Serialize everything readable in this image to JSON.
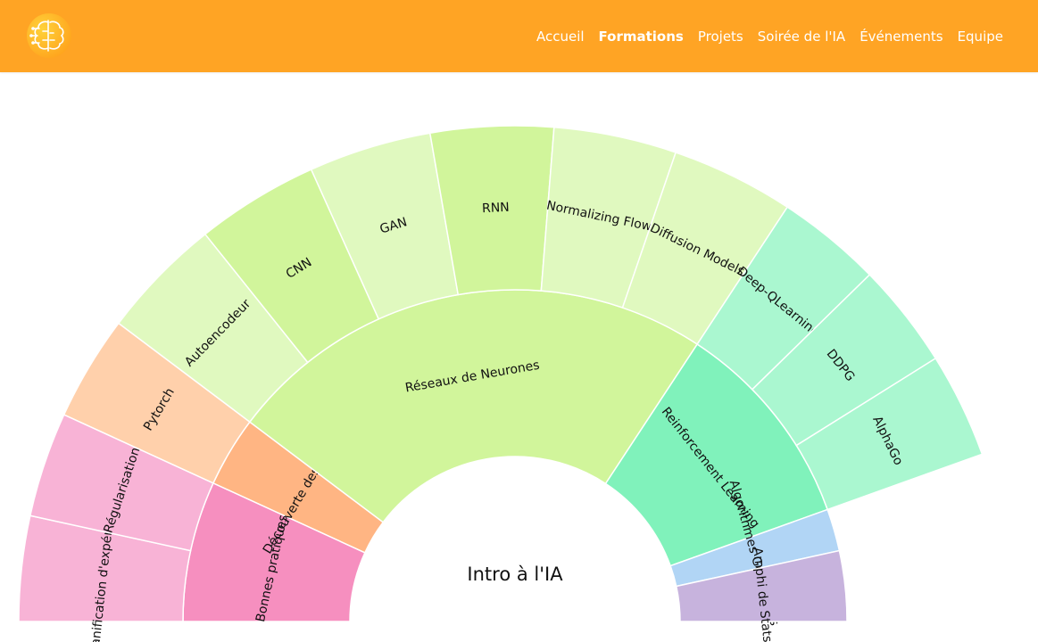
{
  "navbar": {
    "color": "#ffa424",
    "logo_icon": "brain-circuit-icon",
    "links": [
      {
        "label": "Accueil",
        "active": false
      },
      {
        "label": "Formations",
        "active": true
      },
      {
        "label": "Projets",
        "active": false
      },
      {
        "label": "Soirée de l'IA",
        "active": false
      },
      {
        "label": "Événements",
        "active": false
      },
      {
        "label": "Equipe",
        "active": false
      }
    ]
  },
  "chart_data": {
    "type": "sunburst",
    "root": "Intro à l'IA",
    "children": [
      {
        "name": "Bonnes pratiques",
        "color": "#f68fbf",
        "value": 2,
        "children": [
          {
            "name": "Planification d'expérience",
            "color": "#f8b3d6",
            "value": 1
          },
          {
            "name": "Régularisation",
            "color": "#f8b3d6",
            "value": 1
          }
        ]
      },
      {
        "name": "Découverte des outils",
        "color": "#ffb583",
        "value": 1,
        "children": [
          {
            "name": "Pytorch",
            "color": "#ffd0ab",
            "value": 1
          }
        ]
      },
      {
        "name": "Réseaux de Neurones",
        "color": "#d1f59b",
        "value": 7,
        "children": [
          {
            "name": "Autoencodeur",
            "color": "#e0f9bf",
            "value": 1
          },
          {
            "name": "CNN",
            "color": "#d1f59b",
            "value": 1
          },
          {
            "name": "GAN",
            "color": "#e0f9bf",
            "value": 1
          },
          {
            "name": "RNN",
            "color": "#d1f59b",
            "value": 1
          },
          {
            "name": "Normalizing Flow",
            "color": "#e0f9bf",
            "value": 1
          },
          {
            "name": "Diffusion Models",
            "color": "#e0f9bf",
            "value": 1
          }
        ]
      },
      {
        "name": "Reinforcement Learning",
        "color": "#80f2bb",
        "value": 3,
        "children": [
          {
            "name": "Deep-QLearning",
            "color": "#aaf7d0",
            "value": 1
          },
          {
            "name": "DDPG",
            "color": "#aaf7d0",
            "value": 1
          },
          {
            "name": "AlphaGo",
            "color": "#aaf7d0",
            "value": 1
          }
        ]
      },
      {
        "name": "Algorithmes Génétiques",
        "color": "#b1d5f5",
        "value": 0.6,
        "children": []
      },
      {
        "name": "Amphi de Stats",
        "color": "#c7b3dd",
        "value": 1,
        "children": []
      }
    ]
  }
}
